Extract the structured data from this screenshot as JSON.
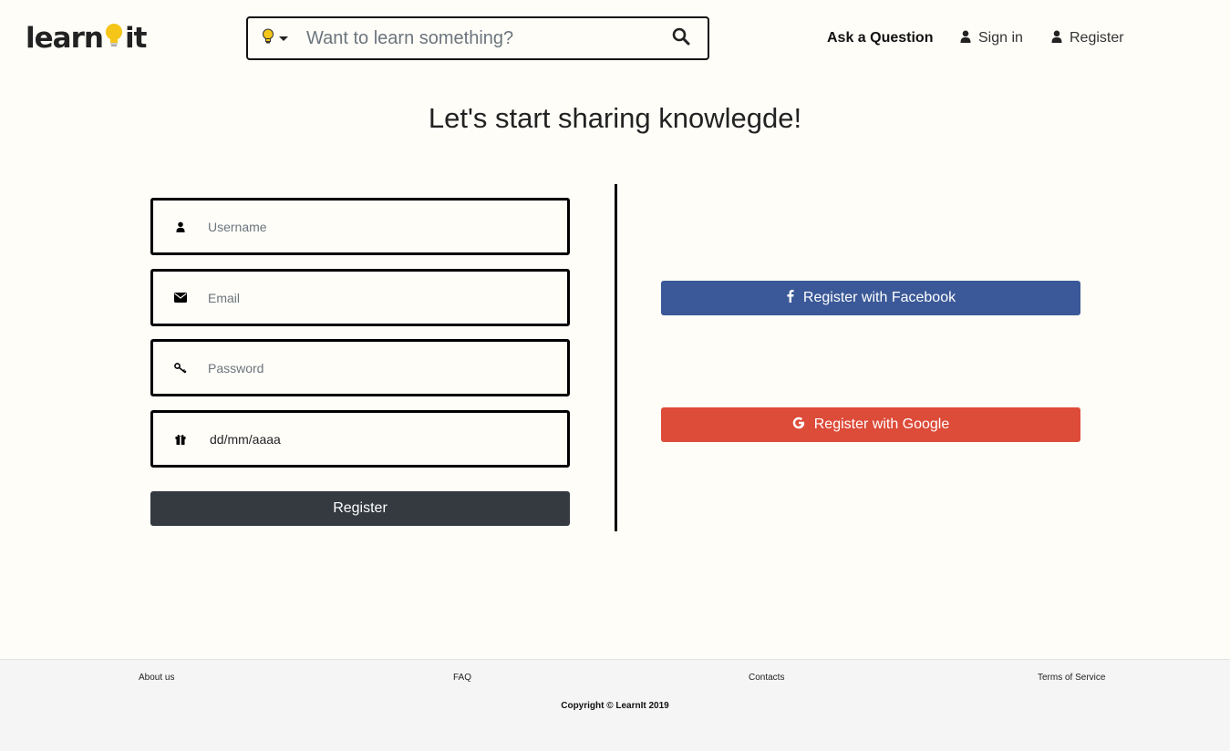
{
  "header": {
    "logo_left": "learn",
    "logo_right": "it",
    "search": {
      "placeholder": "Want to learn something?",
      "category_icon": "lightbulb-icon",
      "search_icon": "search-icon"
    },
    "nav": {
      "ask_question": "Ask a Question",
      "sign_in": "Sign in",
      "register": "Register"
    }
  },
  "main": {
    "title": "Let's start sharing knowlegde!",
    "form": {
      "username_placeholder": "Username",
      "email_placeholder": "Email",
      "password_placeholder": "Password",
      "birthdate_value": "dd/mm/aaaa",
      "register_label": "Register"
    },
    "social": {
      "facebook_label": "Register with Facebook",
      "google_label": "Register with Google"
    }
  },
  "footer": {
    "links": [
      "About us",
      "FAQ",
      "Contacts",
      "Terms of Service"
    ],
    "copyright": "Copyright © LearnIt 2019"
  },
  "colors": {
    "background": "#fefdf8",
    "bulb": "#f5c518",
    "facebook": "#3b5998",
    "google": "#dd4b39",
    "register_button": "#343a40",
    "footer_bg": "#f5f5f5"
  }
}
